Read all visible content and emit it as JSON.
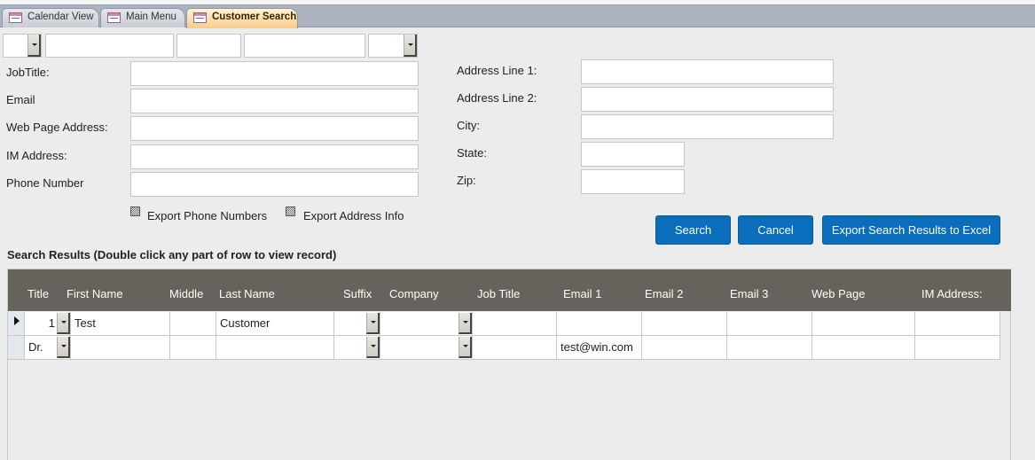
{
  "tabs": [
    {
      "label": "Calendar View",
      "icon": "form-icon",
      "active": false
    },
    {
      "label": "Main Menu",
      "icon": "form-icon",
      "active": false
    },
    {
      "label": "Customer Search",
      "icon": "form-icon",
      "active": true
    }
  ],
  "name_row": {
    "title_value": "",
    "first_name_value": "",
    "middle_value": "",
    "last_name_value": "",
    "suffix_value": ""
  },
  "left_fields": [
    {
      "label": "JobTitle:",
      "value": ""
    },
    {
      "label": "Email",
      "value": ""
    },
    {
      "label": "Web Page Address:",
      "value": ""
    },
    {
      "label": "IM Address:",
      "value": ""
    },
    {
      "label": "Phone Number",
      "value": ""
    }
  ],
  "right_fields": [
    {
      "label": "Address Line 1:",
      "value": ""
    },
    {
      "label": "Address Line 2:",
      "value": ""
    },
    {
      "label": "City:",
      "value": ""
    },
    {
      "label": "State:",
      "value": ""
    },
    {
      "label": "Zip:",
      "value": ""
    }
  ],
  "checkboxes": [
    {
      "label": "Export Phone Numbers",
      "checked": "indeterminate"
    },
    {
      "label": "Export Address Info",
      "checked": "indeterminate"
    }
  ],
  "buttons": {
    "search": "Search",
    "cancel": "Cancel",
    "export": "Export Search Results to Excel"
  },
  "colors": {
    "button": "#0a6ebd",
    "grid_header": "#66625c",
    "active_tab": "#f8cd8a"
  },
  "results": {
    "title": "Search Results (Double click any part of row to view record)",
    "columns": [
      "Title",
      "First Name",
      "Middle",
      "Last Name",
      "Suffix",
      "Company",
      "Job Title",
      "Email 1",
      "Email 2",
      "Email 3",
      "Web Page",
      "IM Address:"
    ],
    "rows": [
      {
        "current": true,
        "cells": [
          "1",
          "Test",
          "",
          "Customer",
          "",
          "",
          "",
          "",
          "",
          "",
          "",
          ""
        ]
      },
      {
        "current": false,
        "cells": [
          "Dr.",
          "",
          "",
          "",
          "",
          "",
          "",
          "test@win.com",
          "",
          "",
          "",
          ""
        ]
      }
    ]
  }
}
